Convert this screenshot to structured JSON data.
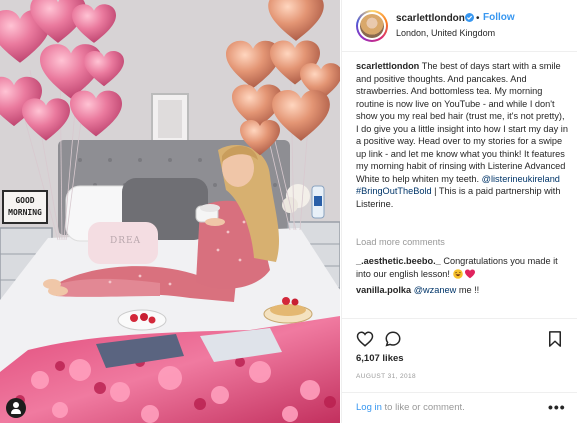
{
  "post": {
    "username": "scarlettlondon",
    "follow_label": "Follow",
    "location": "London, United Kingdom",
    "caption_user": "scarlettlondon",
    "caption_text": "The best of days start with a smile and positive thoughts. And pancakes. And strawberries. And bottomless tea. My morning routine is now live on YouTube - and while I don't show you my real bed hair (trust me, it's not pretty), I do give you a little insight into how I start my day in a positive way. Head over to my stories for a swipe up link - and let me know what you think! It features my morning habit of rinsing with Listerine Advanced White to help whiten my teeth.",
    "caption_mention": "@listerineukireland",
    "caption_hashtag": "#BringOutTheBold",
    "caption_tail": "| This is a paid partnership with Listerine.",
    "load_more": "Load more comments",
    "comments": [
      {
        "user": "_.aesthetic.beebo._",
        "text": "Congratulations you made it into our english lesson!"
      },
      {
        "user": "vanilla.polka",
        "mention": "@wzanew",
        "text": "me !!"
      }
    ],
    "likes": "6,107 likes",
    "date": "AUGUST 31, 2018",
    "footer_login": "Log in",
    "footer_rest": "to like or comment.",
    "more_label": "•••"
  },
  "photo": {
    "lightbox_lines": [
      "GOOD",
      "MORNING",
      "♥"
    ],
    "pillow_text": "DREA"
  },
  "icons": {
    "verified": "verified-badge-icon",
    "like": "heart-outline-icon",
    "comment": "speech-bubble-icon",
    "save": "bookmark-icon",
    "options": "more-dots-icon",
    "emoji_laugh": "laughing-emoji-icon",
    "emoji_heart": "red-heart-emoji-icon"
  },
  "colors": {
    "link": "#003569",
    "follow": "#3897f0",
    "muted": "#999999",
    "balloon_pink": "#e8739a",
    "balloon_rose_gold": "#d98a70"
  }
}
